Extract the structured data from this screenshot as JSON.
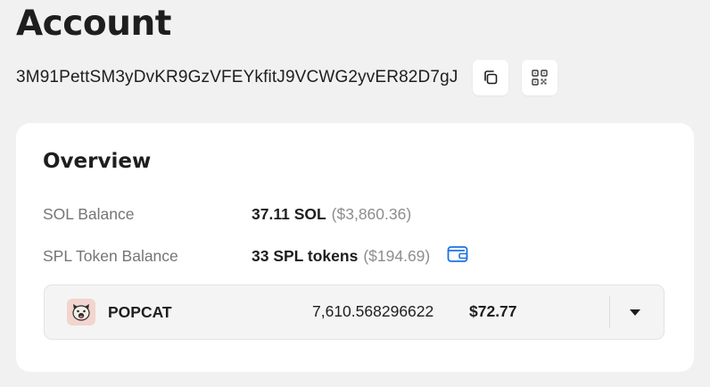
{
  "page": {
    "title": "Account"
  },
  "account": {
    "address": "3M91PettSM3yDvKR9GzVFEYkfitJ9VCWG2yvER82D7gJ",
    "copy_icon": "copy-icon",
    "qr_icon": "qr-code-icon"
  },
  "overview": {
    "title": "Overview",
    "sol_balance": {
      "label": "SOL Balance",
      "amount": "37.11 SOL",
      "usd": "($3,860.36)"
    },
    "spl_balance": {
      "label": "SPL Token Balance",
      "amount": "33 SPL tokens",
      "usd": "($194.69)",
      "icon": "wallet-icon"
    },
    "token": {
      "name": "POPCAT",
      "amount": "7,610.568296622",
      "value": "$72.77",
      "logo_icon": "popcat-logo-icon",
      "expand_icon": "caret-down-icon"
    }
  },
  "colors": {
    "background": "#f1f1f1",
    "card": "#ffffff",
    "text": "#1e1e1e",
    "muted_label": "#757575",
    "muted_value": "#8d8d8d",
    "accent": "#1a73e8",
    "token_row_bg": "#f4f4f4"
  }
}
